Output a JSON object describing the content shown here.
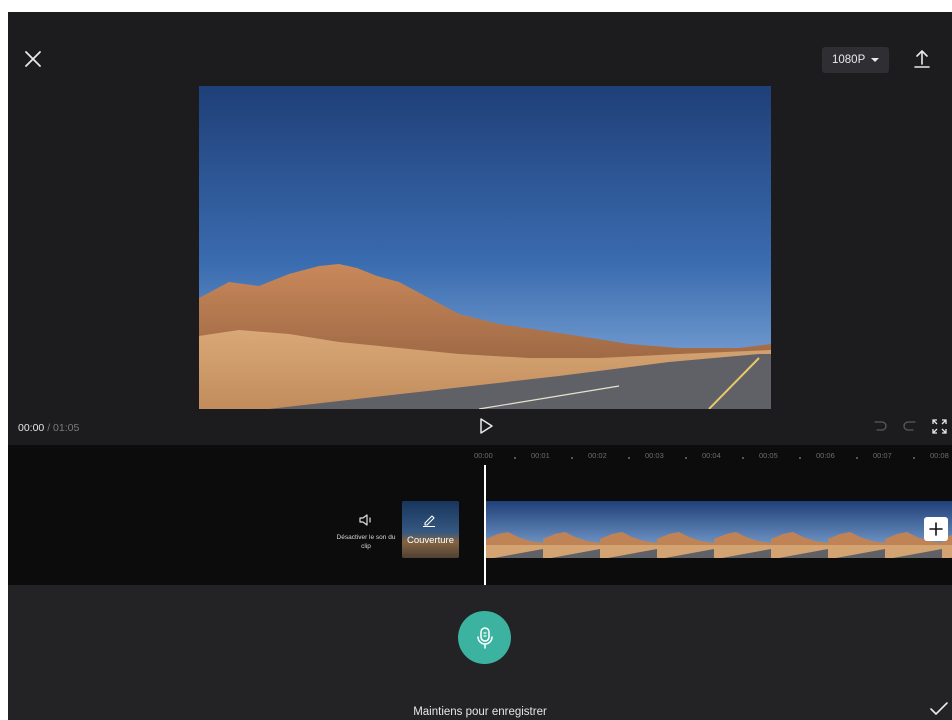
{
  "header": {
    "resolution_label": "1080P",
    "icons": {
      "close": "close-icon",
      "export": "export-icon",
      "caret": "caret-down-icon"
    }
  },
  "playback": {
    "current_time": "00:00",
    "separator": " / ",
    "total_time": "01:05",
    "icons": {
      "play": "play-icon",
      "undo": "undo-icon",
      "redo": "redo-icon",
      "fullscreen": "fullscreen-icon"
    }
  },
  "timeline": {
    "ticks": [
      "00:00",
      "00:01",
      "00:02",
      "00:03",
      "00:04",
      "00:05",
      "00:06",
      "00:07",
      "00:08"
    ],
    "mute_label": "Désactiver le son du clip",
    "cover_label": "Couverture",
    "frame_count": 9,
    "icons": {
      "mute": "speaker-icon",
      "cover_edit": "pencil-icon",
      "add": "plus-icon"
    }
  },
  "record": {
    "hint": "Maintiens pour enregistrer",
    "icons": {
      "mic": "microphone-icon",
      "confirm": "checkmark-icon"
    }
  },
  "colors": {
    "background": "#1c1c1e",
    "timeline_bg": "#0c0c0d",
    "record_panel_bg": "#232325",
    "accent": "#3bb3a0"
  }
}
